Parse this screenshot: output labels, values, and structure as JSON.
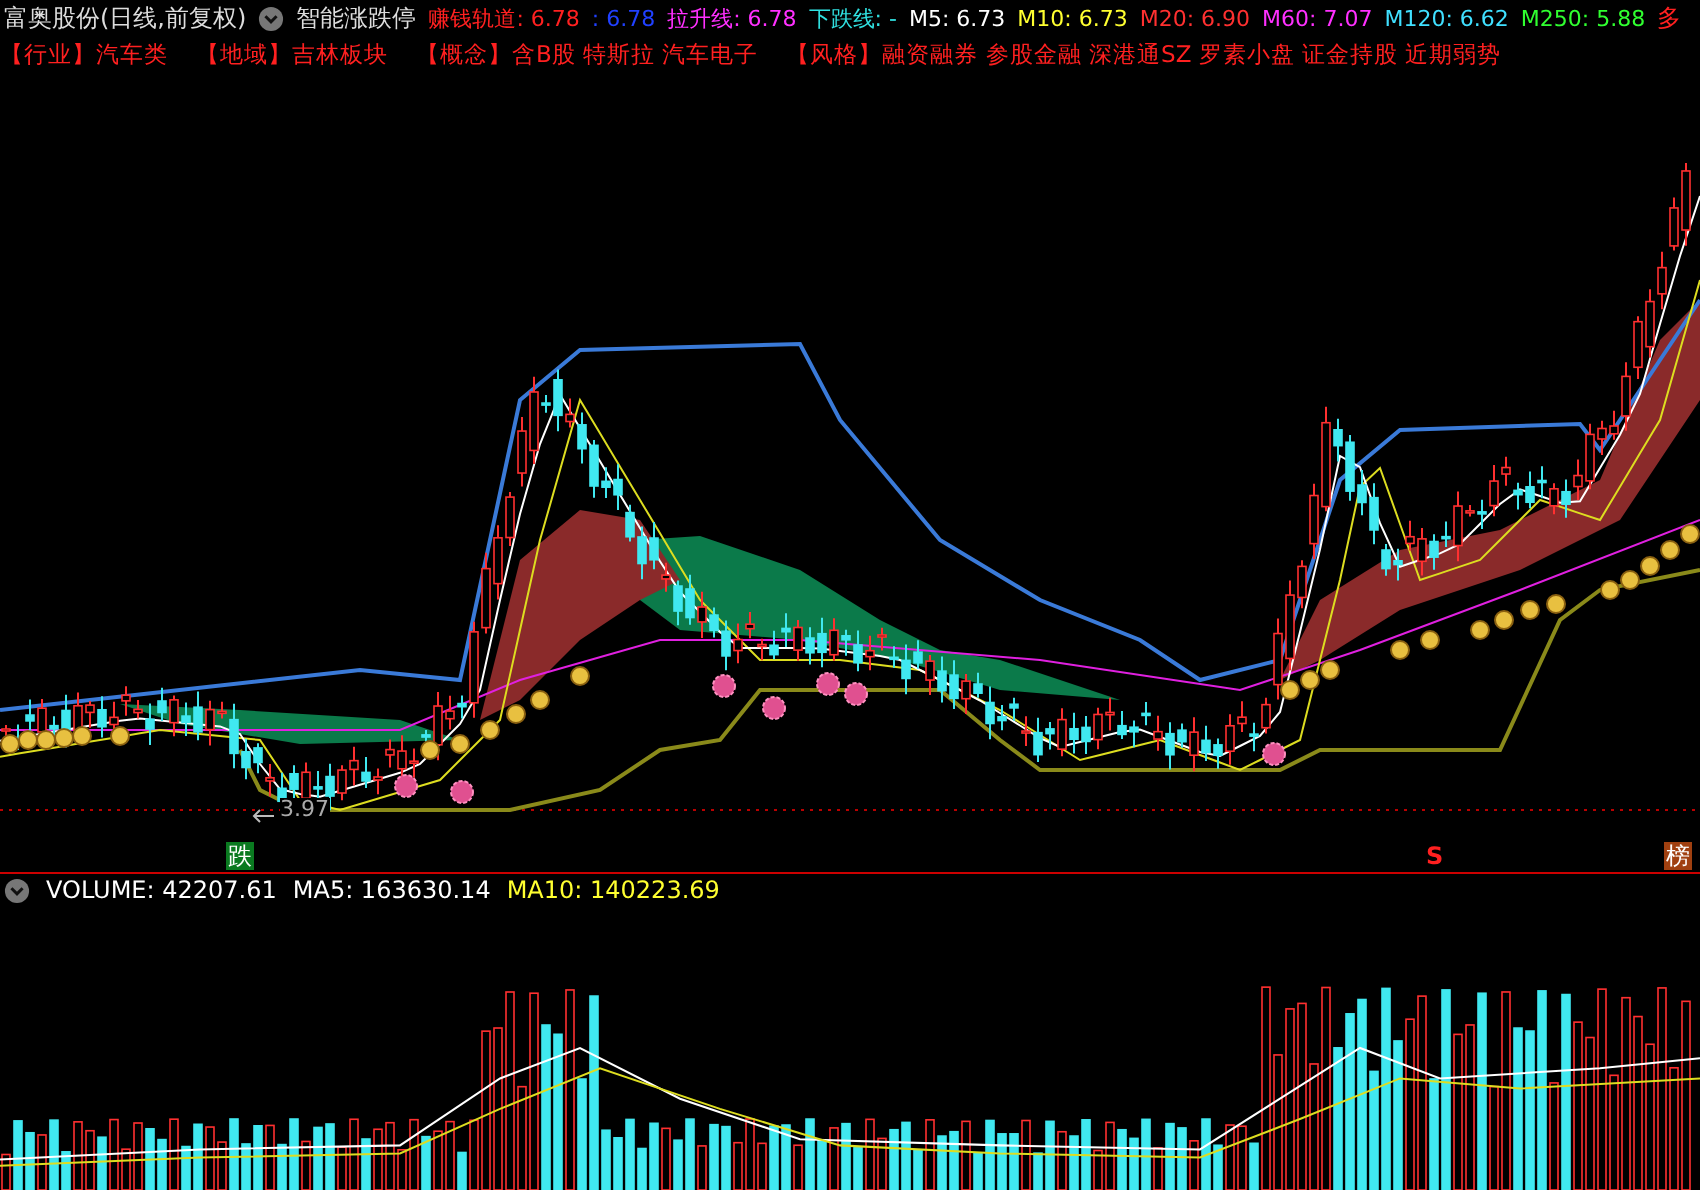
{
  "header": {
    "title": "富奥股份(日线,前复权)",
    "indicator_name": "智能涨跌停",
    "signal": "多",
    "indicators": [
      {
        "label": "赚钱轨道:",
        "value": "6.78",
        "color": "#ff2020"
      },
      {
        "label": ":",
        "value": "6.78",
        "color": "#2040ff"
      },
      {
        "label": "拉升线:",
        "value": "6.78",
        "color": "#ff30ff"
      },
      {
        "label": "下跌线:",
        "value": "-",
        "color": "#30e0e0"
      },
      {
        "label": "M5:",
        "value": "6.73",
        "color": "#ffffff"
      },
      {
        "label": "M10:",
        "value": "6.73",
        "color": "#ffff30"
      },
      {
        "label": "M20:",
        "value": "6.90",
        "color": "#ff3030"
      },
      {
        "label": "M60:",
        "value": "7.07",
        "color": "#ff30ff"
      },
      {
        "label": "M120:",
        "value": "6.62",
        "color": "#40e0ff"
      },
      {
        "label": "M250:",
        "value": "5.88",
        "color": "#30ff30"
      }
    ]
  },
  "tags": [
    {
      "category": "【行业】",
      "items": "汽车类"
    },
    {
      "category": "【地域】",
      "items": "吉林板块"
    },
    {
      "category": "【概念】",
      "items": "含B股 特斯拉 汽车电子"
    },
    {
      "category": "【风格】",
      "items": "融资融券 参股金融 深港通SZ 罗素小盘 证金持股 近期弱势"
    }
  ],
  "price_chart": {
    "low_label": "3.97",
    "markers": [
      {
        "kind": "fall",
        "text": "跌"
      },
      {
        "kind": "sell",
        "text": "S"
      },
      {
        "kind": "rank",
        "text": "榜"
      }
    ]
  },
  "volume": {
    "indicators": [
      {
        "label": "VOLUME:",
        "value": "42207.61",
        "color": "#ffffff"
      },
      {
        "label": "MA5:",
        "value": "163630.14",
        "color": "#ffffff"
      },
      {
        "label": "MA10:",
        "value": "140223.69",
        "color": "#ffff30"
      }
    ]
  }
}
